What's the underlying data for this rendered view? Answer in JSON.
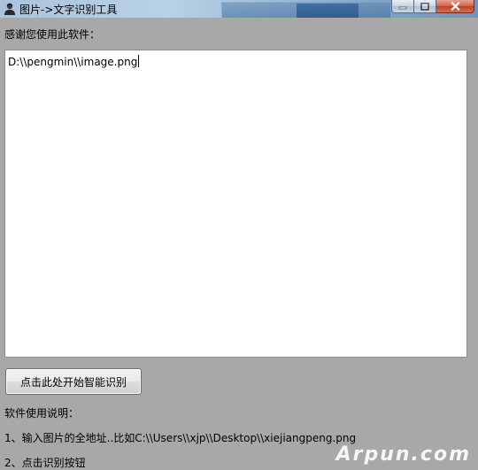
{
  "window": {
    "title": "图片->文字识别工具",
    "controls": {
      "minimize": "minimize-icon",
      "maximize": "maximize-icon",
      "close": "close-icon"
    }
  },
  "main": {
    "thanks_label": "感谢您使用此软件：",
    "path_input_value": "D:\\\\pengmin\\\\image.png",
    "start_button_label": "点击此处开始智能识别",
    "instructions_title": "软件使用说明：",
    "instructions": [
      "1、输入图片的全地址..比如C:\\\\Users\\\\xjp\\\\Desktop\\\\xiejiangpeng.png",
      "2、点击识别按钮"
    ]
  },
  "watermark": "Arpun.com",
  "colors": {
    "client_background": "#a8a8a8",
    "input_background": "#ffffff",
    "close_button": "#c94a2f"
  }
}
